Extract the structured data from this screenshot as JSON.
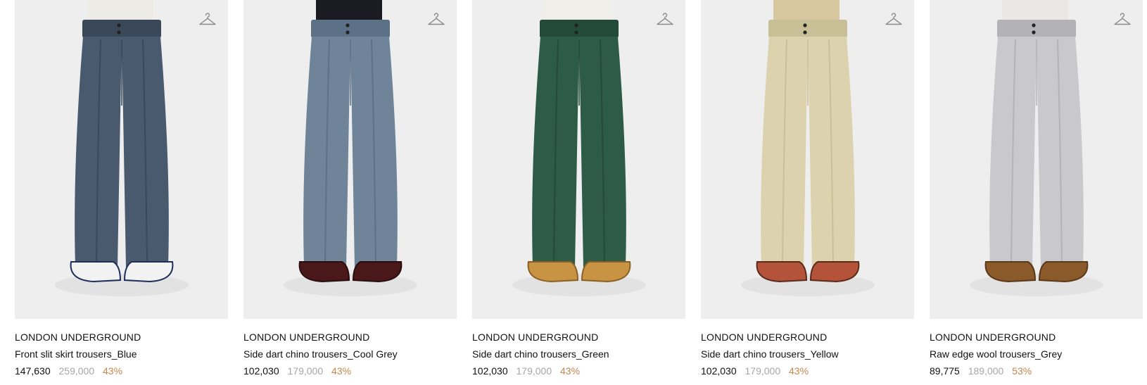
{
  "products": [
    {
      "brand": "LONDON UNDERGROUND",
      "name": "Front slit skirt trousers_Blue",
      "sale_price": "147,630",
      "original_price": "259,000",
      "discount": "43%",
      "colors": {
        "pants": "#4a5a6e",
        "pants_dark": "#3a485a",
        "shirt": "#ecebe6",
        "shoe": "#f2f2f2",
        "shoe_trim": "#1e2e5a"
      }
    },
    {
      "brand": "LONDON UNDERGROUND",
      "name": "Side dart chino trousers_Cool Grey",
      "sale_price": "102,030",
      "original_price": "179,000",
      "discount": "43%",
      "colors": {
        "pants": "#6f8499",
        "pants_dark": "#5c7086",
        "shirt": "#1a1a22",
        "shoe": "#4a1818",
        "shoe_trim": "#2a0e0e"
      }
    },
    {
      "brand": "LONDON UNDERGROUND",
      "name": "Side dart chino trousers_Green",
      "sale_price": "102,030",
      "original_price": "179,000",
      "discount": "43%",
      "colors": {
        "pants": "#2e5b48",
        "pants_dark": "#244a3a",
        "shirt": "#f0efea",
        "shoe": "#c89443",
        "shoe_trim": "#8a6025"
      }
    },
    {
      "brand": "LONDON UNDERGROUND",
      "name": "Side dart chino trousers_Yellow",
      "sale_price": "102,030",
      "original_price": "179,000",
      "discount": "43%",
      "colors": {
        "pants": "#dcd3ae",
        "pants_dark": "#c9bf97",
        "shirt": "#d8c8a0",
        "shoe": "#b5533a",
        "shoe_trim": "#5a2a1a"
      }
    },
    {
      "brand": "LONDON UNDERGROUND",
      "name": "Raw edge wool trousers_Grey",
      "sale_price": "89,775",
      "original_price": "189,000",
      "discount": "53%",
      "colors": {
        "pants": "#c9c9cb",
        "pants_dark": "#b3b3b6",
        "shirt": "#eae8e4",
        "shoe": "#8a5a2a",
        "shoe_trim": "#5a3818"
      }
    }
  ],
  "icons": {
    "wishlist": "hanger-icon"
  },
  "theme": {
    "discount_color": "#c4874f",
    "original_price_color": "#a6a6a6",
    "image_bg": "#eeeeee"
  }
}
